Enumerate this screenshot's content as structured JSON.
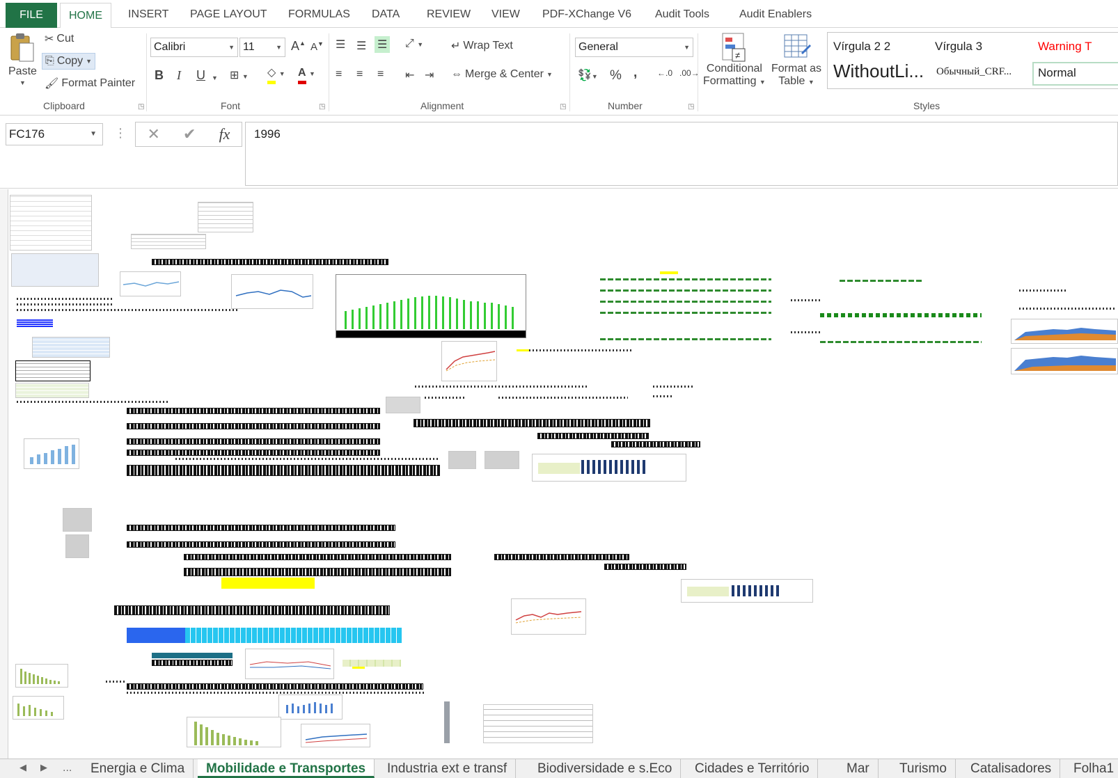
{
  "ribbon_tabs": {
    "file": "FILE",
    "home": "HOME",
    "insert": "INSERT",
    "page_layout": "PAGE LAYOUT",
    "formulas": "FORMULAS",
    "data": "DATA",
    "review": "REVIEW",
    "view": "VIEW",
    "pdfxchange": "PDF-XChange V6",
    "audit_tools": "Audit Tools",
    "audit_enablers": "Audit Enablers"
  },
  "clipboard": {
    "paste": "Paste",
    "cut": "Cut",
    "copy": "Copy",
    "format_painter": "Format Painter",
    "label": "Clipboard"
  },
  "font": {
    "name": "Calibri",
    "size": "11",
    "bold": "B",
    "italic": "I",
    "underline": "U",
    "label": "Font",
    "fill_color": "#ffff00",
    "font_color": "#e00000"
  },
  "alignment": {
    "wrap_text": "Wrap Text",
    "merge_center": "Merge & Center",
    "label": "Alignment"
  },
  "number": {
    "format": "General",
    "percent": "%",
    "comma": ",",
    "label": "Number"
  },
  "styles": {
    "conditional_formatting_1": "Conditional",
    "conditional_formatting_2": "Formatting",
    "format_as_table_1": "Format as",
    "format_as_table_2": "Table",
    "virgula_22": "Vírgula 2 2",
    "virgula_3": "Vírgula 3",
    "warning": "Warning T",
    "withoutli": "WithoutLi...",
    "obychny": "Обычный_CRF...",
    "normal": "Normal",
    "label": "Styles"
  },
  "formula_bar": {
    "name_box": "FC176",
    "formula": "1996"
  },
  "sheet_tabs": [
    "Energia e Clima",
    "Mobilidade e Transportes",
    "Industria ext e transf",
    "Biodiversidade e s.Eco",
    "Cidades e Território",
    "Mar",
    "Turismo",
    "Catalisadores",
    "Folha1"
  ],
  "sheet_nav": {
    "more": "..."
  },
  "colors": {
    "excel_green": "#217346",
    "highlight_yellow": "#ffff00",
    "bar_green": "#33cc33",
    "navy": "#1f3a70"
  }
}
